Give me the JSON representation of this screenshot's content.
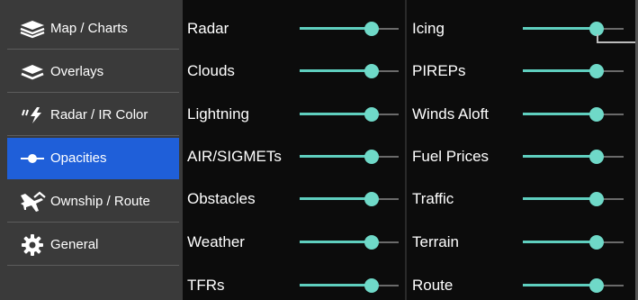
{
  "sidebar": {
    "items": [
      {
        "label": "Map / Charts",
        "icon": "map-layers-icon",
        "active": false
      },
      {
        "label": "Overlays",
        "icon": "layers-icon",
        "active": false
      },
      {
        "label": "Radar / IR Color",
        "icon": "lightning-icon",
        "active": false
      },
      {
        "label": "Opacities",
        "icon": "slider-icon",
        "active": true
      },
      {
        "label": "Ownship / Route",
        "icon": "airplane-route-icon",
        "active": false
      },
      {
        "label": "General",
        "icon": "gear-icon",
        "active": false
      }
    ]
  },
  "opacities": {
    "left": [
      {
        "label": "Radar",
        "value": 0.73
      },
      {
        "label": "Clouds",
        "value": 0.73
      },
      {
        "label": "Lightning",
        "value": 0.73
      },
      {
        "label": "AIR/SIGMETs",
        "value": 0.73
      },
      {
        "label": "Obstacles",
        "value": 0.73
      },
      {
        "label": "Weather",
        "value": 0.73
      },
      {
        "label": "TFRs",
        "value": 0.73
      }
    ],
    "right": [
      {
        "label": "Icing",
        "value": 0.73
      },
      {
        "label": "PIREPs",
        "value": 0.73
      },
      {
        "label": "Winds Aloft",
        "value": 0.73
      },
      {
        "label": "Fuel Prices",
        "value": 0.73
      },
      {
        "label": "Traffic",
        "value": 0.73
      },
      {
        "label": "Terrain",
        "value": 0.73
      },
      {
        "label": "Route",
        "value": 0.73
      }
    ]
  },
  "colors": {
    "accent": "#1f5fd9",
    "slider": "#6fd9c8",
    "sidebar_bg": "#3a3a3a",
    "main_bg": "#0c0c0c"
  }
}
